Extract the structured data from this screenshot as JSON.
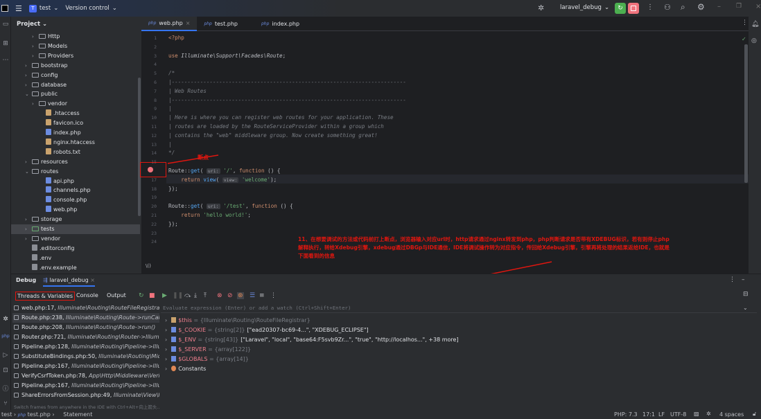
{
  "titlebar": {
    "project": "test",
    "project_badge": "T",
    "version_control": "Version control",
    "run_config": "laravel_debug"
  },
  "project_panel": {
    "title": "Project",
    "items": [
      {
        "label": "Http",
        "type": "folder",
        "level": 3,
        "arrow": "›"
      },
      {
        "label": "Models",
        "type": "folder",
        "level": 3,
        "arrow": "›"
      },
      {
        "label": "Providers",
        "type": "folder",
        "level": 3,
        "arrow": "›"
      },
      {
        "label": "bootstrap",
        "type": "folder",
        "level": 2,
        "arrow": "›"
      },
      {
        "label": "config",
        "type": "folder",
        "level": 2,
        "arrow": "›"
      },
      {
        "label": "database",
        "type": "folder",
        "level": 2,
        "arrow": "›"
      },
      {
        "label": "public",
        "type": "folder",
        "level": 2,
        "arrow": "⌄"
      },
      {
        "label": "vendor",
        "type": "folder",
        "level": 3,
        "arrow": "›"
      },
      {
        "label": ".htaccess",
        "type": "file",
        "level": 4
      },
      {
        "label": "favicon.ico",
        "type": "file",
        "level": 4
      },
      {
        "label": "index.php",
        "type": "php",
        "level": 4
      },
      {
        "label": "nginx.htaccess",
        "type": "file",
        "level": 4
      },
      {
        "label": "robots.txt",
        "type": "file",
        "level": 4
      },
      {
        "label": "resources",
        "type": "folder",
        "level": 2,
        "arrow": "›"
      },
      {
        "label": "routes",
        "type": "folder",
        "level": 2,
        "arrow": "⌄"
      },
      {
        "label": "api.php",
        "type": "php",
        "level": 4
      },
      {
        "label": "channels.php",
        "type": "php",
        "level": 4
      },
      {
        "label": "console.php",
        "type": "php",
        "level": 4
      },
      {
        "label": "web.php",
        "type": "php",
        "level": 4
      },
      {
        "label": "storage",
        "type": "folder",
        "level": 2,
        "arrow": "›"
      },
      {
        "label": "tests",
        "type": "folder",
        "level": 2,
        "arrow": "›",
        "selected": true
      },
      {
        "label": "vendor",
        "type": "folder",
        "level": 2,
        "arrow": "›"
      },
      {
        "label": ".editorconfig",
        "type": "file",
        "level": 2
      },
      {
        "label": ".env",
        "type": "file",
        "level": 2
      },
      {
        "label": ".env.example",
        "type": "file",
        "level": 2
      }
    ]
  },
  "editor": {
    "tabs": [
      {
        "label": "web.php",
        "active": true
      },
      {
        "label": "test.php"
      },
      {
        "label": "index.php"
      }
    ],
    "breadcrumb": "\\()",
    "lines": [
      "<span class='kw'>&lt;?php</span>",
      "",
      "<span class='kw'>use</span> <span class='ns'>Illuminate\\Support\\Facades\\Route</span>;",
      "",
      "<span class='cm'>/*</span>",
      "<span class='cm'>|--------------------------------------------------------------------------</span>",
      "<span class='cm'>| Web Routes</span>",
      "<span class='cm'>|--------------------------------------------------------------------------</span>",
      "<span class='cm'>|</span>",
      "<span class='cm'>| Here is where you can register web routes for your application. These</span>",
      "<span class='cm'>| routes are loaded by the RouteServiceProvider within a group which</span>",
      "<span class='cm'>| contains the \"web\" middleware group. Now create something great!</span>",
      "<span class='cm'>|</span>",
      "<span class='cm'>*/</span>",
      "",
      "Route::<span class='fn'>get</span>( <span class='hint'>uri:</span> <span class='st'>'/'</span>, <span class='kw'>function</span> () {",
      "    <span class='kw'>return</span> <span class='fn'>view</span>( <span class='hint'>view:</span> <span class='st'>'welcome'</span>);",
      "});",
      "",
      "Route::<span class='fn'>get</span>( <span class='hint'>uri:</span> <span class='st'>'/test'</span>, <span class='kw'>function</span> () {",
      "    <span class='kw'>return</span> <span class='st'>'hello world!'</span>;",
      "});",
      "",
      ""
    ]
  },
  "annotations": {
    "breakpoint": "断点",
    "explanation": "11、在想要调试的方法或代码前打上断点，浏览器输入对应url时，http请求通过nginx转发到php，php判断请求是否带有XDEBUG标识，若有则停止php解释执行，转给Xdebug引擎，xdebug通过DBGp与IDE通信，IDE将调试操作转为对应指令，传回给Xdebug引擎，引擎再将处理的结果返给IDE，也就是下面看到的信息"
  },
  "debug": {
    "title": "Debug",
    "session": "laravel_debug",
    "tabs": [
      "Threads & Variables",
      "Console",
      "Output"
    ],
    "frames": [
      {
        "loc": "web.php:17, ",
        "cls": "Illuminate\\Routing\\RouteFileRegistrar->{closure}"
      },
      {
        "loc": "Route.php:238, ",
        "cls": "Illuminate\\Routing\\Route->runCallable()"
      },
      {
        "loc": "Route.php:208, ",
        "cls": "Illuminate\\Routing\\Route->run()"
      },
      {
        "loc": "Router.php:721, ",
        "cls": "Illuminate\\Routing\\Router->Illuminate\\Routing\\{closure}"
      },
      {
        "loc": "Pipeline.php:128, ",
        "cls": "Illuminate\\Routing\\Pipeline->Illuminate\\Pipeline\\{closure}"
      },
      {
        "loc": "SubstituteBindings.php:50, ",
        "cls": "Illuminate\\Routing\\Middleware\\SubstituteBindings->handle()"
      },
      {
        "loc": "Pipeline.php:167, ",
        "cls": "Illuminate\\Routing\\Pipeline->Illuminate\\Pipeline\\{closure}"
      },
      {
        "loc": "VerifyCsrfToken.php:78, ",
        "cls": "App\\Http\\Middleware\\VerifyCsrfToken->handle()"
      },
      {
        "loc": "Pipeline.php:167, ",
        "cls": "Illuminate\\Routing\\Pipeline->Illuminate\\Pipeline\\{closure}"
      },
      {
        "loc": "ShareErrorsFromSession.php:49, ",
        "cls": "Illuminate\\View\\Middleware\\ShareErrorsFromSession->handle()"
      }
    ],
    "frames_hint": "Switch frames from anywhere in the IDE with Ctrl+Alt+向上箭头...",
    "evaluate_placeholder": "Evaluate expression (Enter) or add a watch (Ctrl+Shift+Enter)",
    "variables": [
      {
        "name": "$this",
        "type": "{Illuminate\\Routing\\RouteFileRegistrar}",
        "value": ""
      },
      {
        "name": "$_COOKIE",
        "type": "{string[2]}",
        "value": "[\"ead20307-bc69-4...\", \"XDEBUG_ECLIPSE\"]"
      },
      {
        "name": "$_ENV",
        "type": "{string[43]}",
        "value": "[\"Laravel\", \"local\", \"base64:F5svb9Zr...\", \"true\", \"http://localhos...\", +38 more]"
      },
      {
        "name": "$_SERVER",
        "type": "{array[122]}",
        "value": ""
      },
      {
        "name": "$GLOBALS",
        "type": "{array[14]}",
        "value": ""
      },
      {
        "name": "Constants",
        "type": "",
        "value": ""
      }
    ]
  },
  "statusbar": {
    "crumbs": [
      "test",
      "test.php",
      "Statement"
    ],
    "php": "PHP: 7.3",
    "pos": "17:1",
    "eol": "LF",
    "enc": "UTF-8",
    "indent": "4 spaces"
  },
  "colors": {
    "accent": "#3574f0",
    "annotation": "#e0160f",
    "resume": "#4caf50",
    "stop": "#f0737d"
  }
}
